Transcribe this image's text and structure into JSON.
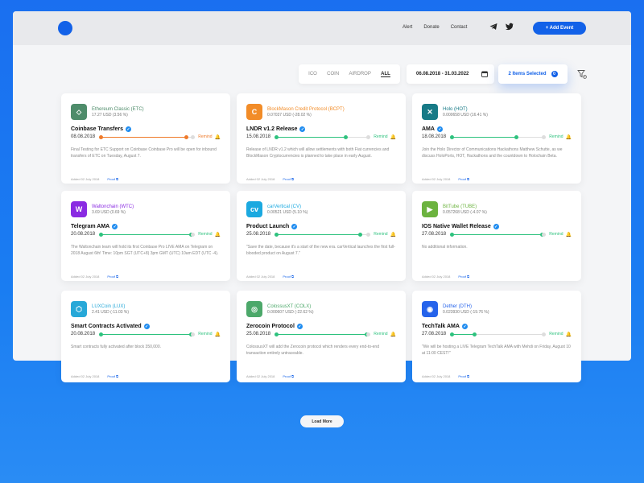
{
  "nav": {
    "alert": "Alert",
    "donate": "Donate",
    "contact": "Contact"
  },
  "add_event_label": "+ Add Event",
  "filters": [
    "ICO",
    "COIN",
    "AIRDROP",
    "ALL"
  ],
  "date_range": "06.08.2018 - 31.03.2022",
  "selected": {
    "label": "2 Items Selected",
    "count": "0"
  },
  "load_more": "Load More",
  "cards": [
    {
      "name": "Ethereum Classic (ETC)",
      "price": "17.27 USD (3.56 %)",
      "title": "Coinbase Transfers",
      "date": "08.08.2018",
      "remind": "Remind",
      "desc": "Final Testing for ETC Support on Coinbase Coinbase Pro will be open for inbound transfers of ETC on Tuesday, August 7.",
      "added": "Added 02 July 2018",
      "proof": "Proof",
      "color": "#ef7a2a",
      "icon_bg": "#4e8c6a",
      "icon": "ethereum-classic-icon",
      "progress": 0.92
    },
    {
      "name": "BlockMason Credit Protocol (BCPT)",
      "price": "0.07037 USD (-28.02 %)",
      "title": "LNDR v1.2 Release",
      "date": "15.08.2018",
      "remind": "Remind",
      "desc": "Release of LNDR v1.2 which will allow settlements with both Fiat currencies and BlockMason Cryptocurrencies is planned to take place in early August.",
      "added": "Added 02 July 2018",
      "proof": "Proof",
      "color": "#2ec27e",
      "icon_bg": "#f28c28",
      "icon": "blockmason-icon",
      "progress": 0.75
    },
    {
      "name": "Holo (HOT)",
      "price": "0.000658 USD (16.41 %)",
      "title": "AMA",
      "date": "18.08.2018",
      "remind": "Remind",
      "desc": "Join the Holo Director of Communications Hackathons Matthew Schutte, as we discuss HoloPorts, HOT, Hackathons and the countdown to Holochain Beta.",
      "added": "Added 02 July 2018",
      "proof": "Proof",
      "color": "#2ec27e",
      "icon_bg": "#177a86",
      "icon": "holo-icon",
      "progress": 0.7
    },
    {
      "name": "Waltonchain (WTC)",
      "price": "3.69 USD (0.69 %)",
      "title": "Telegram AMA",
      "date": "20.08.2018",
      "remind": "Remind",
      "desc": "The Waltonchain team will hold its first Coinbase Pro LIVE AMA on Telegram on 2018 August 6th! Time: 10pm SGT (UTC+8) 3pm GMT (UTC) 10am EDT (UTC -4).",
      "added": "Added 02 July 2018",
      "proof": "Proof",
      "color": "#2ec27e",
      "icon_bg": "#8a2be2",
      "icon": "waltonchain-icon",
      "progress": 0.97
    },
    {
      "name": "carVertical (CV)",
      "price": "0.00521 USD (5.10 %)",
      "title": "Product Launch",
      "date": "25.08.2018",
      "remind": "Remind",
      "desc": "\"Save the date, because it's a start of the new era. carVertical launches the first full-blooded product on August 7.\"",
      "added": "Added 02 July 2018",
      "proof": "Proof",
      "color": "#2ec27e",
      "icon_bg": "#1ba9e0",
      "icon": "carvertical-icon",
      "progress": 0.9
    },
    {
      "name": "BitTube (TUBE)",
      "price": "0.057268 USD (-4.07 %)",
      "title": "IOS Native Wallet Release",
      "date": "27.08.2018",
      "remind": "Remind",
      "desc": "No additional information.",
      "added": "Added 02 July 2018",
      "proof": "Proof",
      "color": "#2ec27e",
      "icon_bg": "#6cb33f",
      "icon": "bittube-icon",
      "progress": 0.97
    },
    {
      "name": "LUXCoin (LUX)",
      "price": "2.41 USD (-11.03 %)",
      "title": "Smart Contracts Activated",
      "date": "20.08.2018",
      "remind": "Remind",
      "desc": "Smart contracts fully activated after block 350,000.",
      "added": "Added 02 July 2018",
      "proof": "Proof",
      "color": "#2ec27e",
      "icon_bg": "#27a8d8",
      "icon": "luxcoin-icon",
      "progress": 0.97
    },
    {
      "name": "ColossusXT (COLX)",
      "price": "0.000607 USD (-22.62 %)",
      "title": "Zerocoin Protocol",
      "date": "25.08.2018",
      "remind": "Remind",
      "desc": "ColossusXT will add the Zerocoin protocol which renders every end-to-end transaction entirely untraceable.",
      "added": "Added 02 July 2018",
      "proof": "Proof",
      "color": "#2ec27e",
      "icon_bg": "#4ca86a",
      "icon": "colossusxt-icon",
      "progress": 0.97
    },
    {
      "name": "Dether (DTH)",
      "price": "0.023930 USD (-19.76 %)",
      "title": "TechTalk AMA",
      "date": "27.08.2018",
      "remind": "Remind",
      "desc": "\"We will be hosting a LIVE Telegram TechTalk AMA with Mehdi on Friday, August 10 at 11:00 CEST!\"",
      "added": "Added 02 July 2018",
      "proof": "Proof",
      "color": "#2ec27e",
      "icon_bg": "#2563eb",
      "icon": "dether-icon",
      "progress": 0.25
    }
  ]
}
